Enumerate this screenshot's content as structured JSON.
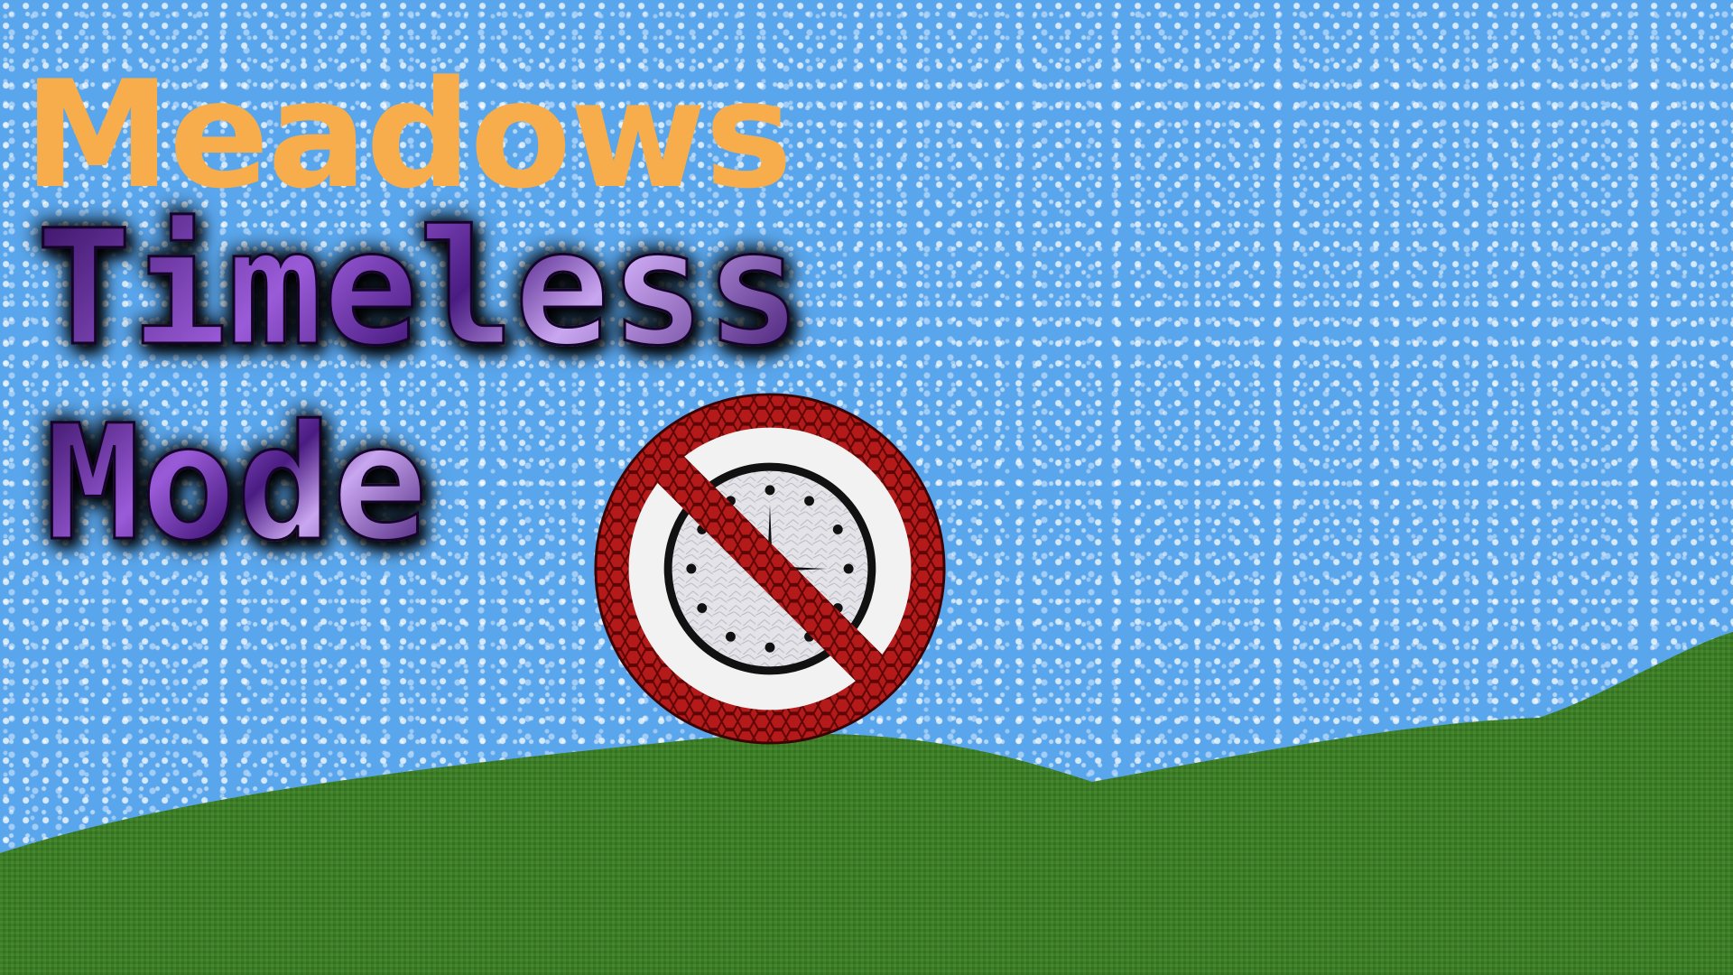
{
  "title": {
    "game_name": "Meadows",
    "mode_line_1": "Timeless",
    "mode_line_2": "Mode"
  },
  "icons": {
    "badge": "no-clock-icon"
  },
  "colors": {
    "sky": "#5aa6ec",
    "grass": "#3d7d27",
    "title_orange": "#f7ad4b",
    "lightning_purple": "#6a2ea0",
    "prohibition_red": "#b51a1a",
    "badge_white": "#f2f2f2"
  }
}
